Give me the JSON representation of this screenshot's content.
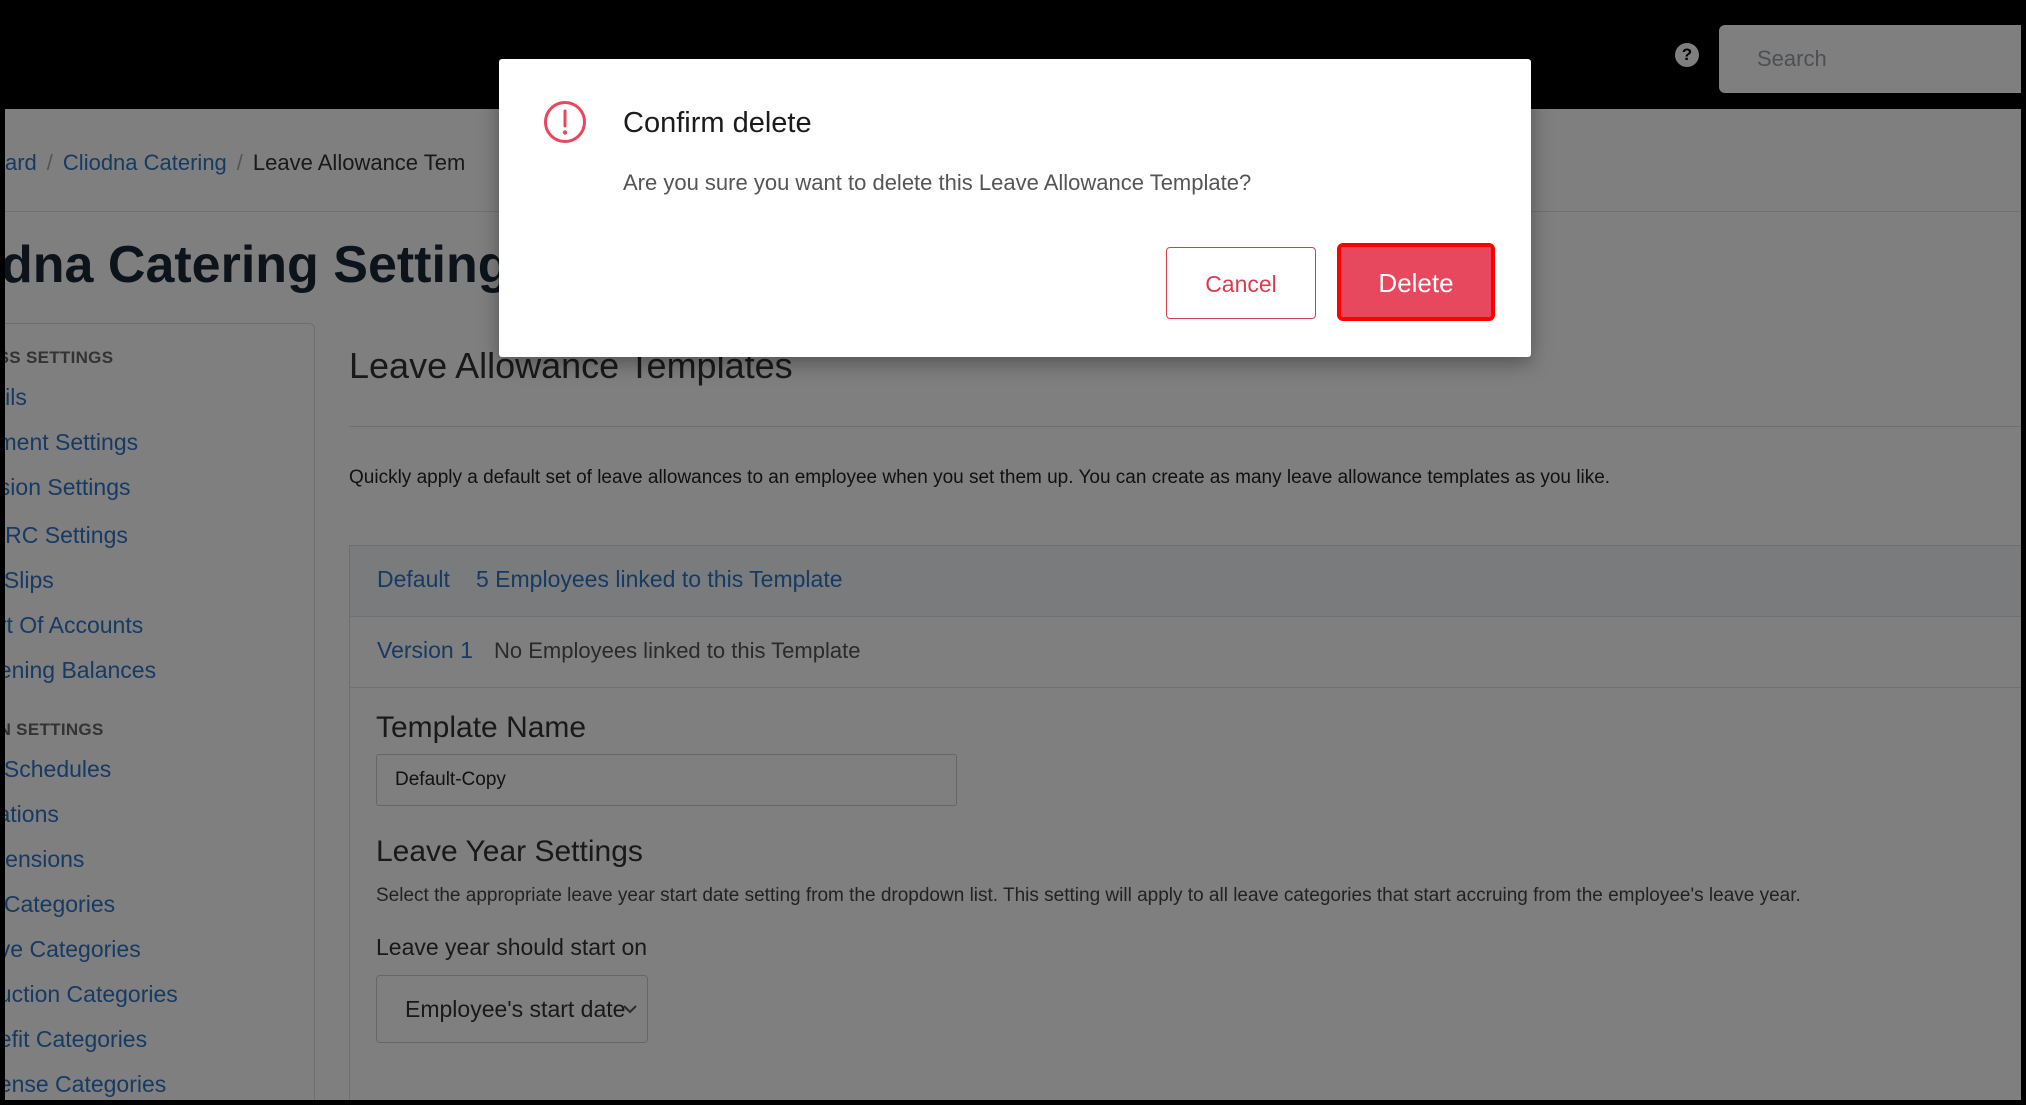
{
  "header": {
    "help_icon": "help-circle-icon",
    "search_placeholder": "Search"
  },
  "breadcrumb": {
    "items": [
      "ard",
      "Cliodna Catering"
    ],
    "current": "Leave Allowance Tem"
  },
  "page": {
    "title": "dna Catering Settings"
  },
  "sidebar": {
    "section_business": "ESS SETTINGS",
    "business_items": [
      "tails",
      "yment Settings",
      "nsion Settings",
      "MRC Settings",
      "y Slips",
      "art Of Accounts",
      "pening Balances"
    ],
    "section_run": "UN SETTINGS",
    "run_items": [
      "y Schedules",
      "cations",
      "mensions",
      "y Categories",
      "ave Categories",
      "duction Categories",
      "nefit Categories",
      "pense Categories"
    ]
  },
  "main": {
    "heading": "Leave Allowance Templates",
    "intro": "Quickly apply a default set of leave allowances to an employee when you set them up. You can create as many leave allowance templates as you like.",
    "templates": [
      {
        "name": "Default",
        "linked": "5 Employees linked to this Template"
      },
      {
        "name": "Version 1",
        "linked": "No Employees linked to this Template"
      }
    ],
    "template_name_label": "Template Name",
    "template_name_value": "Default-Copy",
    "leave_year_heading": "Leave Year Settings",
    "leave_year_help": "Select the appropriate leave year start date setting from the dropdown list. This setting will apply to all leave categories that start accruing from the employee's leave year.",
    "leave_start_label": "Leave year should start on",
    "leave_start_value": "Employee's start date"
  },
  "modal": {
    "icon": "exclamation-circle-icon",
    "title": "Confirm delete",
    "message": "Are you sure you want to delete this Leave Allowance Template?",
    "cancel_label": "Cancel",
    "delete_label": "Delete"
  },
  "colors": {
    "link": "#2f74c6",
    "danger": "#e8485d",
    "highlight_border": "#ff0000"
  }
}
